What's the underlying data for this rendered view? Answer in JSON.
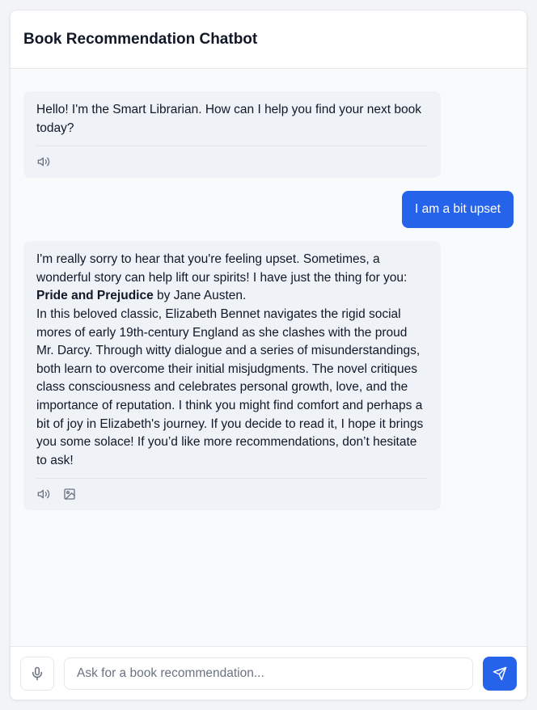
{
  "header": {
    "title": "Book Recommendation Chatbot"
  },
  "messages": [
    {
      "role": "bot",
      "text": "Hello! I'm the Smart Librarian. How can I help you find your next book today?",
      "actions": [
        "speaker-icon"
      ]
    },
    {
      "role": "user",
      "text": "I am a bit upset"
    },
    {
      "role": "bot",
      "intro": "I'm really sorry to hear that you're feeling upset. Sometimes, a wonderful story can help lift our spirits! I have just the thing for you:",
      "book_title": "Pride and Prejudice",
      "book_author_suffix": " by Jane Austen.",
      "body": "In this beloved classic, Elizabeth Bennet navigates the rigid social mores of early 19th-century England as she clashes with the proud Mr. Darcy. Through witty dialogue and a series of misunderstandings, both learn to overcome their initial misjudgments. The novel critiques class consciousness and celebrates personal growth, love, and the importance of reputation. I think you might find comfort and perhaps a bit of joy in Elizabeth's journey. If you decide to read it, I hope it brings you some solace! If you’d like more recommendations, don’t hesitate to ask!",
      "actions": [
        "speaker-icon",
        "image-icon"
      ]
    }
  ],
  "input": {
    "placeholder": "Ask for a book recommendation...",
    "value": ""
  },
  "colors": {
    "accent": "#2563eb",
    "bot_bubble": "#eff2f7",
    "text": "#111827",
    "muted": "#6b7280"
  }
}
